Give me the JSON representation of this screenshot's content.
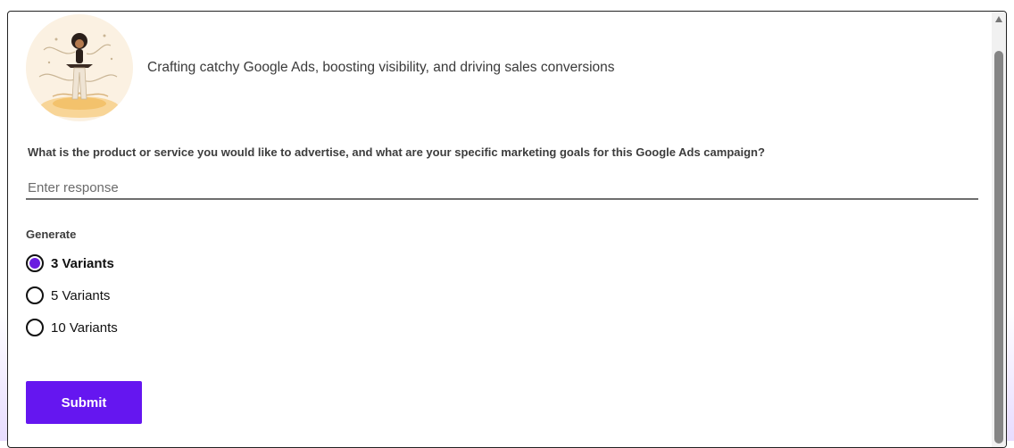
{
  "header": {
    "tagline": "Crafting catchy Google Ads, boosting visibility, and driving sales conversions",
    "avatar_icon": "illustrated-woman-avatar"
  },
  "form": {
    "question": "What is the product or service you would like to advertise, and what are your specific marketing goals for this Google Ads campaign?",
    "response_placeholder": "Enter response",
    "response_value": "",
    "generate_label": "Generate",
    "options": [
      {
        "label": "3 Variants",
        "selected": true
      },
      {
        "label": "5 Variants",
        "selected": false
      },
      {
        "label": "10 Variants",
        "selected": false
      }
    ],
    "submit_label": "Submit"
  },
  "colors": {
    "accent": "#6516f0",
    "radio_fill": "#6a1de0"
  }
}
